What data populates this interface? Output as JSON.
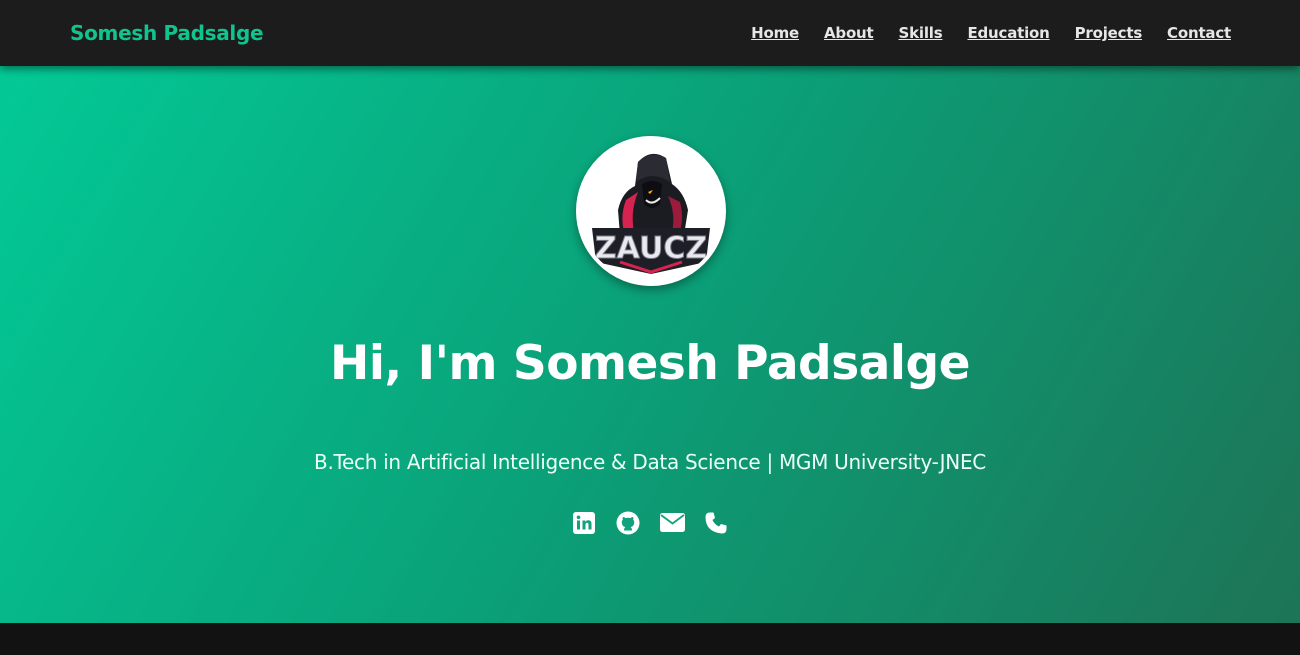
{
  "brand": {
    "name": "Somesh Padsalge",
    "color": "#10c48d"
  },
  "nav": {
    "links": [
      "Home",
      "About",
      "Skills",
      "Education",
      "Projects",
      "Contact"
    ]
  },
  "hero": {
    "avatar_icon": "zaucz-logo-avatar",
    "avatar_text": "ZAUCZ",
    "title": "Hi, I'm Somesh Padsalge",
    "subtitle": "B.Tech in Artificial Intelligence & Data Science | MGM University-JNEC",
    "gradient": [
      "#03c996",
      "#1d7456"
    ],
    "socials": [
      {
        "icon": "linkedin-icon"
      },
      {
        "icon": "github-icon"
      },
      {
        "icon": "email-icon"
      },
      {
        "icon": "phone-icon"
      }
    ]
  }
}
